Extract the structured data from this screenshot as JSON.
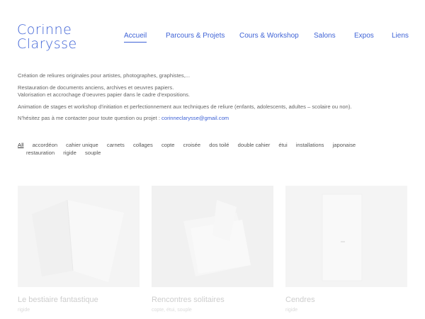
{
  "logo": {
    "line1": "Corinne",
    "line2": "Clarysse"
  },
  "nav": [
    {
      "label": "Accueil",
      "active": true
    },
    {
      "label": "Parcours & Projets"
    },
    {
      "label": "Cours & Workshop"
    },
    {
      "label": "Salons"
    },
    {
      "label": "Expos"
    },
    {
      "label": "Liens"
    }
  ],
  "intro": {
    "p1": "Création de reliures originales pour artistes, photographes, graphistes,...",
    "p2a": "Restauration de documents anciens, archives et oeuvres papiers.",
    "p2b": "Valorisation et accrochage d’oeuvres papier dans le cadre d’expositions.",
    "p3": "Animation de stages et workshop d’initiation et perfectionnement aux techniques de reliure (enfants, adolescents, adultes – scolaire ou non).",
    "p4_prefix": "N’hésitez pas à me contacter pour toute question ou projet : ",
    "email": "corinneclarysse@gmail.com"
  },
  "filters": {
    "row1": [
      "All",
      "accordéon",
      "cahier unique",
      "carnets",
      "collages",
      "copte",
      "croisée",
      "dos toilé",
      "double cahier",
      "étui",
      "installations",
      "japonaise"
    ],
    "row2": [
      "restauration",
      "rigide",
      "souple"
    ]
  },
  "cards": [
    {
      "title": "Le bestiaire fantastique",
      "tags": "rigide"
    },
    {
      "title": "Rencontres solitaires",
      "tags": "copte, étui, souple"
    },
    {
      "title": "Cendres",
      "tags": "rigide"
    }
  ]
}
